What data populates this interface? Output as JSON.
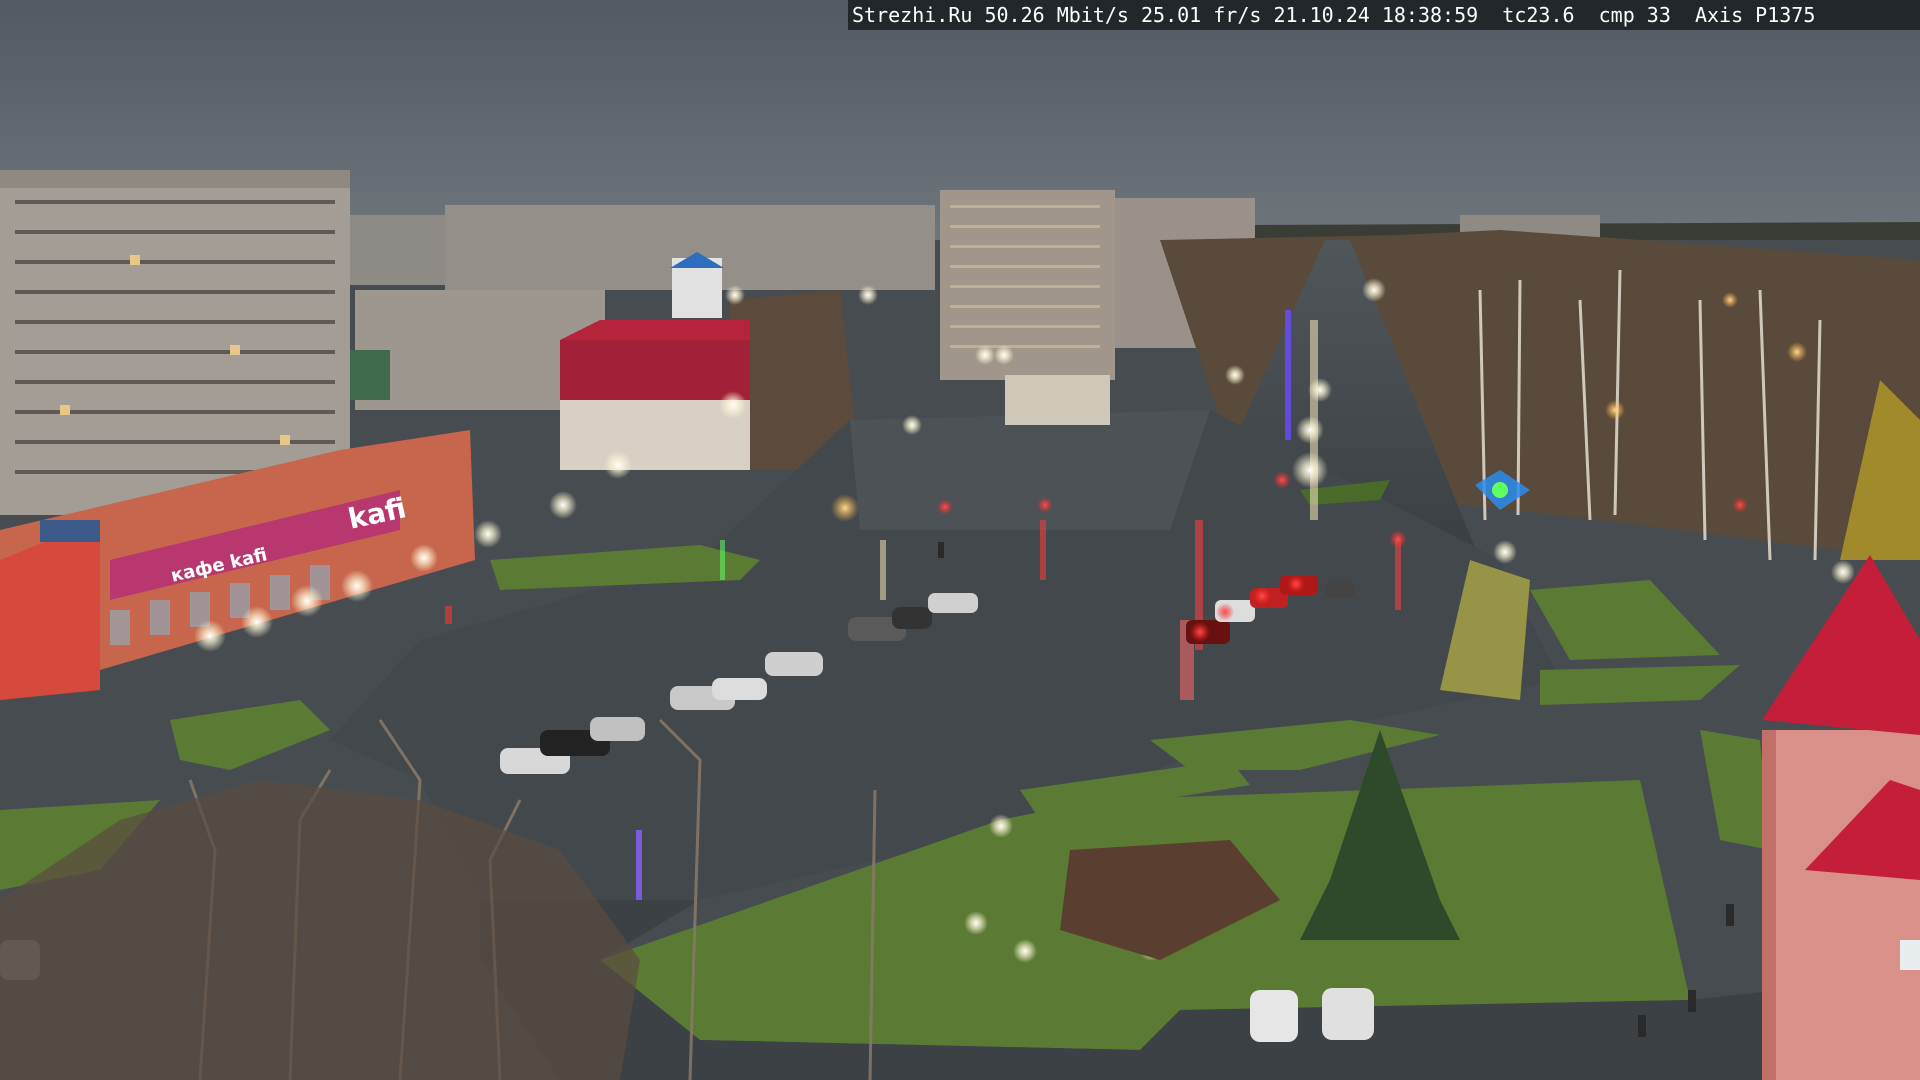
{
  "overlay": {
    "site": "Strezhi.Ru",
    "bitrate": "50.26 Mbit/s",
    "framerate": "25.01 fr/s",
    "timestamp": "21.10.24 18:38:59",
    "tc": "tc23.6",
    "cmp": "cmp 33",
    "camera": "Axis P1375"
  },
  "signage": {
    "store_name": "kafi",
    "store_banner": "кафе kafi"
  },
  "scene": {
    "description_icon": "city-square-webcam-image",
    "colors": {
      "sky": "#4d555f",
      "asphalt": "#3d4246",
      "grass": "#5b7a34",
      "brick": "#c2654a",
      "panel_building": "#a89f96",
      "red_roof": "#b5243a",
      "store_magenta": "#b7376e"
    }
  }
}
